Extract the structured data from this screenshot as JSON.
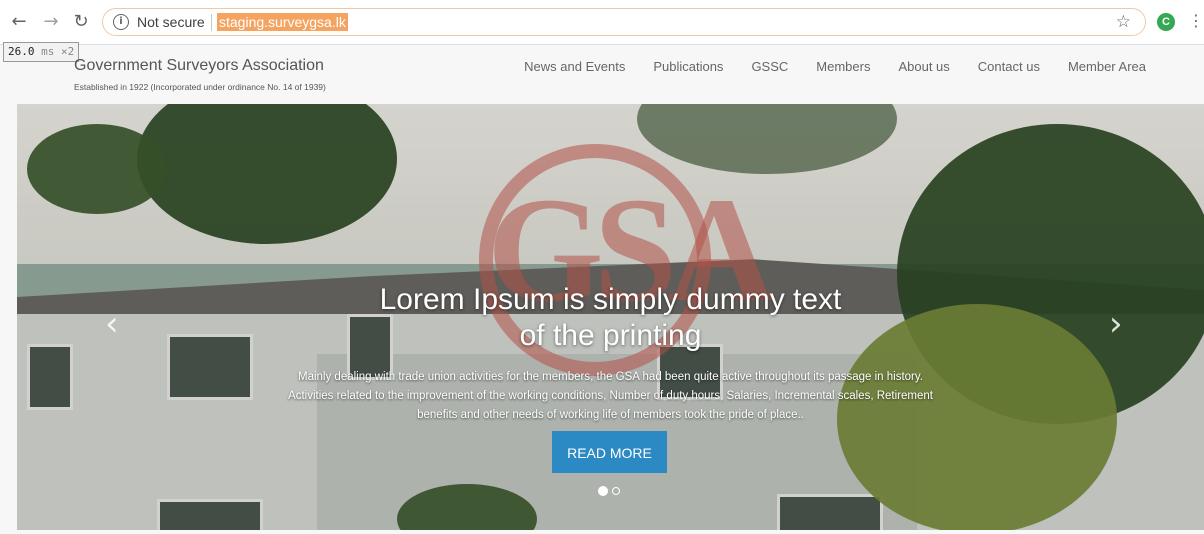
{
  "browser": {
    "security_label": "Not secure",
    "url": "staging.surveygsa.lk",
    "profile_initial": "C",
    "icons": [
      "back-icon",
      "forward-icon",
      "reload-icon",
      "info-icon",
      "star-icon",
      "kebab-menu-icon"
    ]
  },
  "perf_badge": {
    "time": "26.0",
    "unit": "ms",
    "multiplier": "×2"
  },
  "site": {
    "title": "Government Surveyors Association",
    "subtitle": "Established in 1922 (Incorporated under ordinance No. 14 of 1939)",
    "nav": [
      "News and Events",
      "Publications",
      "GSSC",
      "Members",
      "About us",
      "Contact us",
      "Member Area"
    ]
  },
  "hero": {
    "headline_line1": "Lorem Ipsum is simply dummy text",
    "headline_line2": "of the printing",
    "body_line1": "Mainly dealing with trade union activities for the members, the GSA had been quite active throughout its passage in history.",
    "body_line2": "Activities related to the improvement of the working conditions, Number of duty hours, Salaries, Incremental scales, Retirement",
    "body_line3": "benefits and other needs of working life of members took the pride of place..",
    "button": "READ MORE",
    "slides_total": 2,
    "slide_active": 1,
    "logo_watermark": "GSA"
  },
  "colors": {
    "accent_button": "#2b89c4",
    "url_highlight": "#f4a460",
    "profile": "#34a853"
  }
}
